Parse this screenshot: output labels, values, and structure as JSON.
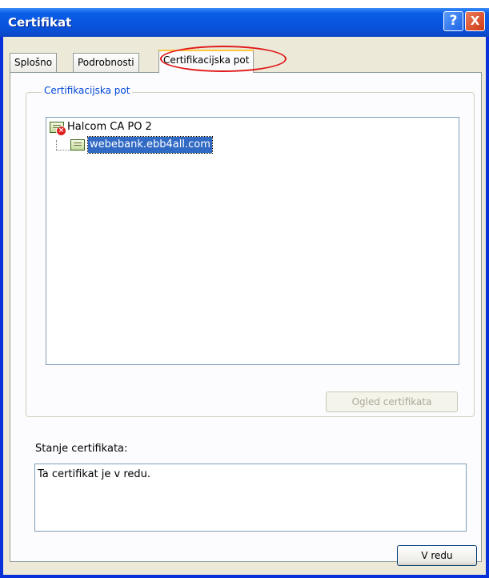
{
  "window": {
    "title": "Certifikat",
    "help_glyph": "?",
    "close_glyph": "X"
  },
  "tabs": [
    {
      "label": "Splošno",
      "active": false
    },
    {
      "label": "Podrobnosti",
      "active": false
    },
    {
      "label": "Certifikacijska pot",
      "active": true
    }
  ],
  "path_group": {
    "label": "Certifikacijska pot",
    "tree": [
      {
        "label": "Halcom CA PO 2",
        "icon": "certificate-error-icon",
        "level": 0,
        "selected": false
      },
      {
        "label": "webebank.ebb4all.com",
        "icon": "certificate-icon",
        "level": 1,
        "selected": true
      }
    ],
    "view_button": "Ogled certifikata"
  },
  "status": {
    "label": "Stanje certifikata:",
    "text": "Ta certifikat je v redu."
  },
  "ok_button": "V redu",
  "colors": {
    "titlebar": "#0a5ee6",
    "client_bg": "#ece9d8",
    "selection": "#316ac5",
    "group_label": "#0046d5",
    "annotation": "#e01818"
  }
}
